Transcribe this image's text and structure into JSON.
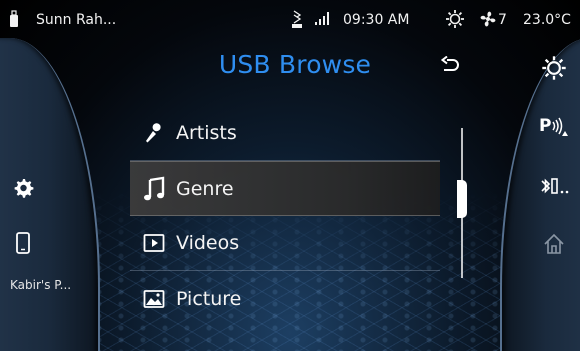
{
  "status_bar": {
    "source_name": "Sunn Rah...",
    "time": "09:30 AM",
    "fan_speed": "7",
    "temperature": "23.0°C",
    "icons": [
      "usb-stick-icon",
      "bluetooth-usb-icon",
      "signal-strength-icon",
      "climate-icon",
      "fan-icon"
    ]
  },
  "header": {
    "title": "USB Browse",
    "back_icon": "back-arrow-icon"
  },
  "menu": {
    "selected_index": 1,
    "items": [
      {
        "label": "Artists",
        "icon": "microphone-icon"
      },
      {
        "label": "Genre",
        "icon": "music-note-icon"
      },
      {
        "label": "Videos",
        "icon": "play-video-icon"
      },
      {
        "label": "Picture",
        "icon": "picture-icon"
      }
    ]
  },
  "left_panel": {
    "phone_name": "Kabir's P...",
    "icons": [
      "settings-icon",
      "phone-icon"
    ]
  },
  "right_panel": {
    "icons": [
      "climate-icon",
      "parking-sensor-icon",
      "bluetooth-media-icon",
      "home-icon"
    ]
  },
  "colors": {
    "title_accent": "#2f8ef0",
    "panel_edge": "#56708f",
    "background_glow": "#1d3f63"
  }
}
